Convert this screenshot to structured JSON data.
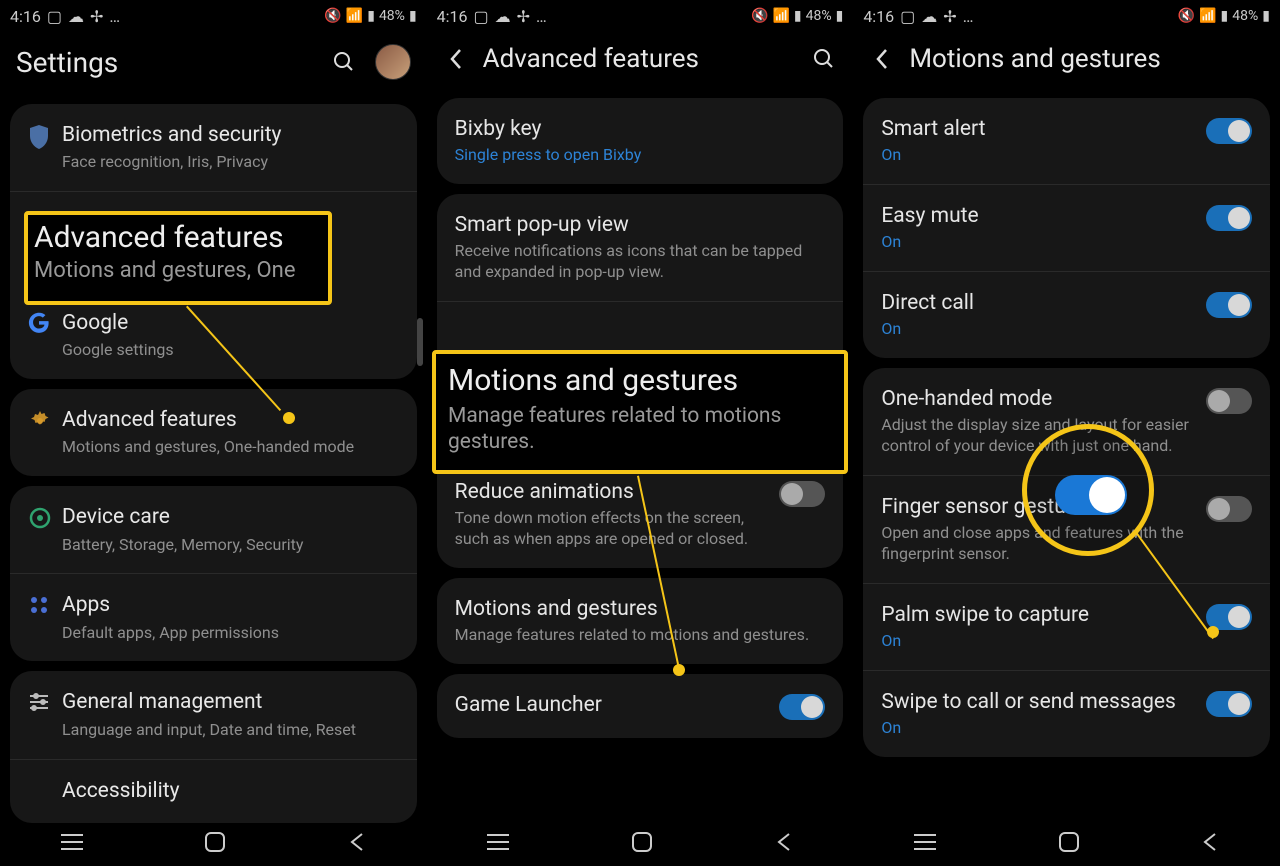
{
  "statusbar": {
    "time": "4:16",
    "battery": "48%"
  },
  "screen1": {
    "header": {
      "title": "Settings"
    },
    "card1": {
      "r1": {
        "label": "Biometrics and security",
        "sub": "Face recognition, Iris, Privacy"
      },
      "r2": {
        "label": "Google",
        "sub": "Google settings"
      }
    },
    "card2": {
      "r1": {
        "label": "Advanced features",
        "sub": "Motions and gestures, One-handed mode"
      }
    },
    "card3": {
      "r1": {
        "label": "Device care",
        "sub": "Battery, Storage, Memory, Security"
      },
      "r2": {
        "label": "Apps",
        "sub": "Default apps, App permissions"
      }
    },
    "card4": {
      "r1": {
        "label": "General management",
        "sub": "Language and input, Date and time, Reset"
      },
      "r2": {
        "label": "Accessibility"
      }
    },
    "callout": {
      "title": "Advanced features",
      "sub": "Motions and gestures, One"
    }
  },
  "screen2": {
    "header": {
      "title": "Advanced features"
    },
    "card1": {
      "r1": {
        "label": "Bixby key",
        "sub": "Single press to open Bixby"
      }
    },
    "card2": {
      "r1": {
        "label": "Smart pop-up view",
        "sub": "Receive notifications as icons that can be tapped and expanded in pop-up view."
      },
      "r3": {
        "label": "Reduce animations",
        "sub": "Tone down motion effects on the screen, such as when apps are opened or closed."
      }
    },
    "card3": {
      "r1": {
        "label": "Motions and gestures",
        "sub": "Manage features related to motions and gestures."
      }
    },
    "card4": {
      "r1": {
        "label": "Game Launcher"
      }
    },
    "callout": {
      "title": "Motions and gestures",
      "sub": "Manage features related to motions gestures."
    }
  },
  "screen3": {
    "header": {
      "title": "Motions and gestures"
    },
    "group1": {
      "r1": {
        "label": "Smart alert",
        "sub": "On"
      },
      "r2": {
        "label": "Easy mute",
        "sub": "On"
      },
      "r3": {
        "label": "Direct call",
        "sub": "On"
      }
    },
    "group2": {
      "r1": {
        "label": "One-handed mode",
        "sub": "Adjust the display size and layout for easier control of your device with just one hand."
      },
      "r2": {
        "label": "Finger sensor gestures",
        "sub": "Open and close apps and features with the fingerprint sensor."
      },
      "r3": {
        "label": "Palm swipe to capture",
        "sub": "On"
      },
      "r4": {
        "label": "Swipe to call or send messages",
        "sub": "On"
      }
    }
  }
}
